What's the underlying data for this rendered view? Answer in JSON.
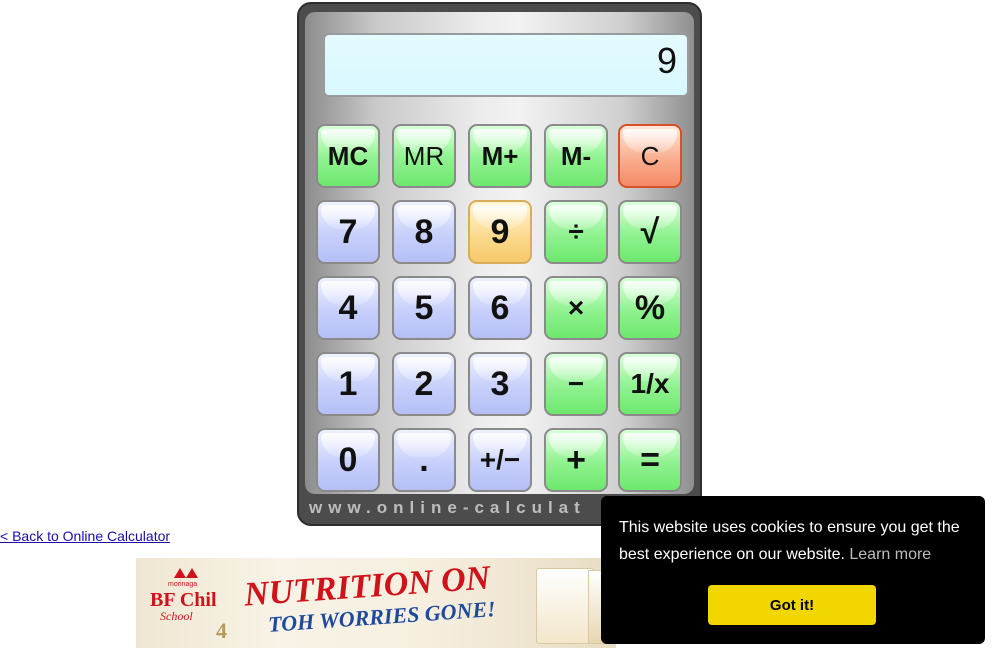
{
  "calculator": {
    "display_value": "9",
    "brand_text": "www.online-calculat",
    "memory_row": [
      "MC",
      "MR",
      "M+",
      "M-",
      "C"
    ],
    "row1": [
      "7",
      "8",
      "9",
      "÷",
      "√"
    ],
    "row2": [
      "4",
      "5",
      "6",
      "×",
      "%"
    ],
    "row3": [
      "1",
      "2",
      "3",
      "−",
      "1/x"
    ],
    "row4": [
      "0",
      ".",
      "+/−",
      "+",
      "="
    ]
  },
  "back_link": "< Back to Online Calculator",
  "ad": {
    "brand_small": "morinaga",
    "brand": "BF Chil",
    "brand_script": "School",
    "number": "4",
    "headline": "NUTRITION ON",
    "subline": "TOH WORRIES GONE!"
  },
  "cookie": {
    "message": "This website uses cookies to ensure you get the best experience on our website.",
    "learn_more": "Learn more",
    "button": "Got it!"
  },
  "colors": {
    "key_green": "#8ff28f",
    "key_blue": "#c7d0fb",
    "key_clear": "#f9a989",
    "key_active": "#fbd98a",
    "cookie_button": "#f1d600",
    "display_bg": "#dff9ff"
  }
}
